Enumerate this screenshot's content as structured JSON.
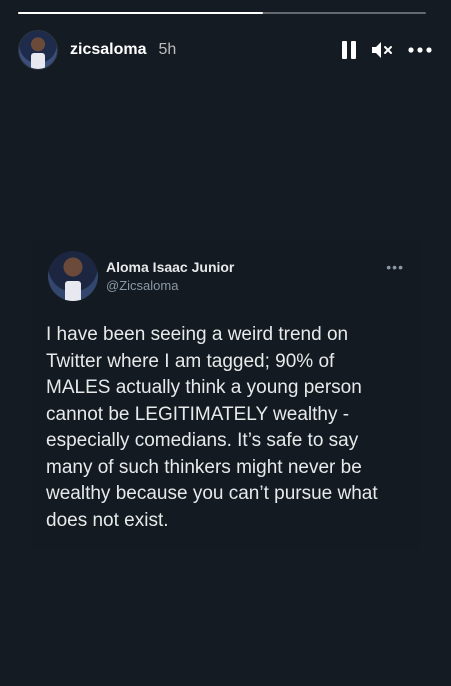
{
  "story": {
    "progress": 0.6,
    "username": "zicsaloma",
    "time": "5h",
    "icons": [
      "pause-icon",
      "mute-icon",
      "more-options-icon"
    ]
  },
  "tweet": {
    "display_name": "Aloma Isaac Junior",
    "handle": "@Zicsaloma",
    "more": "•••",
    "lines": [
      "I have been seeing a weird trend on",
      "Twitter where I am tagged; 90% of",
      "MALES actually think a young person",
      "cannot  be LEGITIMATELY wealthy -",
      "especially comedians. It’s safe to say",
      "many of such thinkers might never be",
      "wealthy because you can’t pursue what",
      "does not exist."
    ]
  },
  "colors": {
    "background": "#141b22",
    "text": "#ffffff",
    "tweet_text": "#e7e9ea",
    "muted": "#8b98a5"
  }
}
